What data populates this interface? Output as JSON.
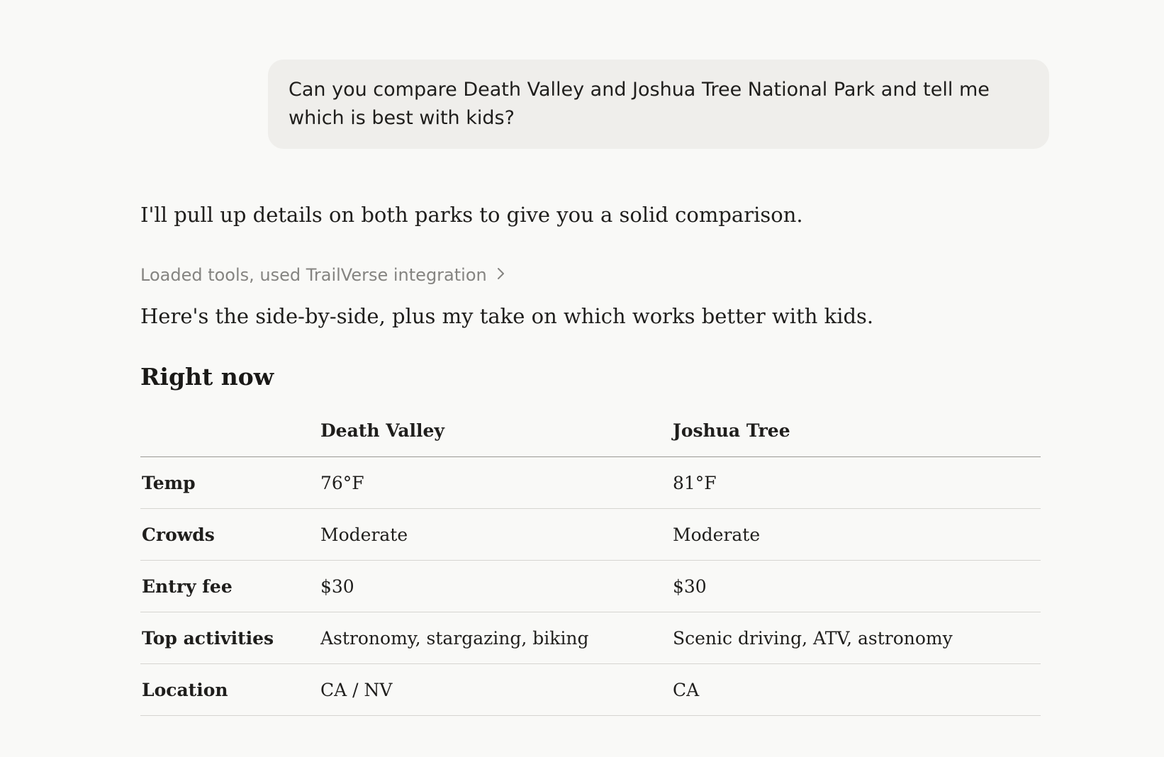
{
  "user_message": {
    "text": "Can you compare Death Valley and Joshua Tree National Park and tell me which is best with kids?"
  },
  "assistant": {
    "intro": "I'll pull up details on both parks to give you a solid comparison.",
    "tool_status": {
      "label": "Loaded tools, used TrailVerse integration",
      "icon": "chevron-right-icon"
    },
    "followup": "Here's the side-by-side, plus my take on which works better with kids.",
    "section_heading": "Right now",
    "table": {
      "columns": [
        "",
        "Death Valley",
        "Joshua Tree"
      ],
      "rows": [
        {
          "label": "Temp",
          "death_valley": "76°F",
          "joshua_tree": "81°F"
        },
        {
          "label": "Crowds",
          "death_valley": "Moderate",
          "joshua_tree": "Moderate"
        },
        {
          "label": "Entry fee",
          "death_valley": "$30",
          "joshua_tree": "$30"
        },
        {
          "label": "Top activities",
          "death_valley": "Astronomy, stargazing, biking",
          "joshua_tree": "Scenic driving, ATV, astronomy"
        },
        {
          "label": "Location",
          "death_valley": "CA / NV",
          "joshua_tree": "CA"
        }
      ]
    }
  },
  "colors": {
    "background": "#f9f9f7",
    "bubble": "#efeeeb",
    "text": "#1f1e1c",
    "muted": "#858481"
  }
}
